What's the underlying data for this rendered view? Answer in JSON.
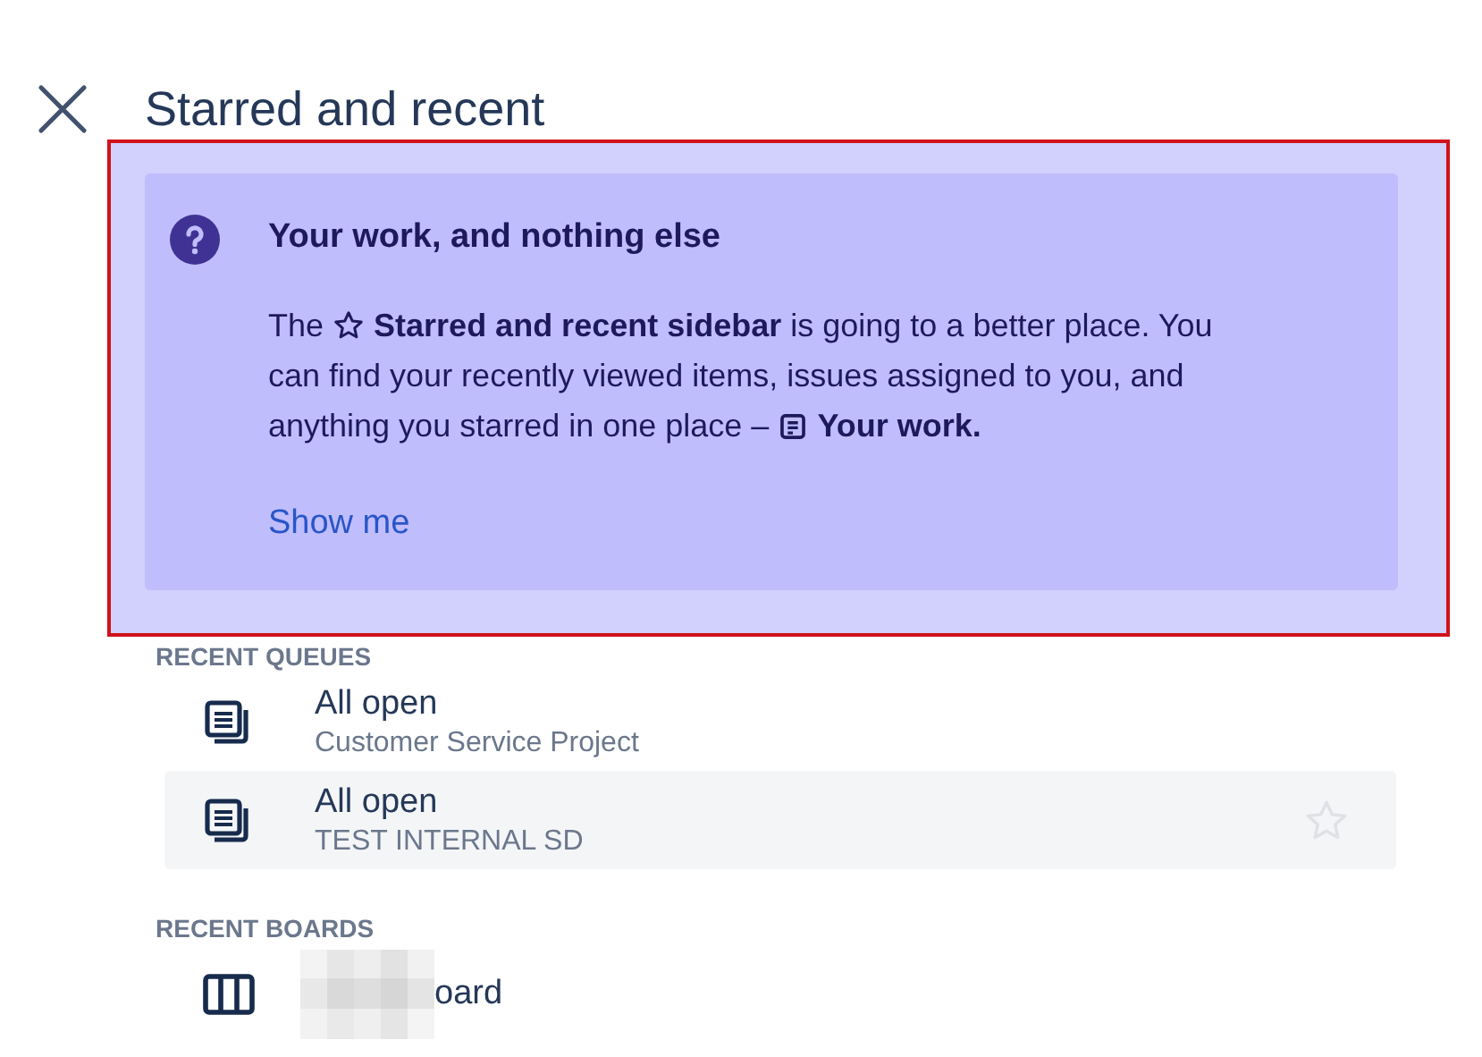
{
  "header": {
    "title": "Starred and recent"
  },
  "notice": {
    "title": "Your work, and nothing else",
    "paragraph": [
      [
        {
          "kind": "text",
          "text": "The"
        },
        {
          "kind": "star"
        },
        {
          "kind": "text",
          "text": "**Starred and recent sidebar** is going to a better place. You"
        }
      ],
      [
        {
          "kind": "text",
          "text": "can find your recently viewed items, issues assigned to you, and"
        }
      ],
      [
        {
          "kind": "text",
          "text": "anything you starred in one place –"
        },
        {
          "kind": "document"
        },
        {
          "kind": "text",
          "text": "Your work.",
          "bold": true
        }
      ]
    ],
    "link": "Show me"
  },
  "sections": [
    {
      "heading": "RECENT QUEUES",
      "items": [
        {
          "kind": "queue",
          "title": "All open",
          "subtitle": "Customer Service Project",
          "hovered": false
        },
        {
          "kind": "queue",
          "title": "All open",
          "subtitle": "TEST INTERNAL SD",
          "hovered": true
        }
      ]
    },
    {
      "heading": "RECENT BOARDS",
      "items": [
        {
          "kind": "board",
          "title": "oard",
          "redacted": true,
          "hovered": false
        }
      ]
    }
  ]
}
